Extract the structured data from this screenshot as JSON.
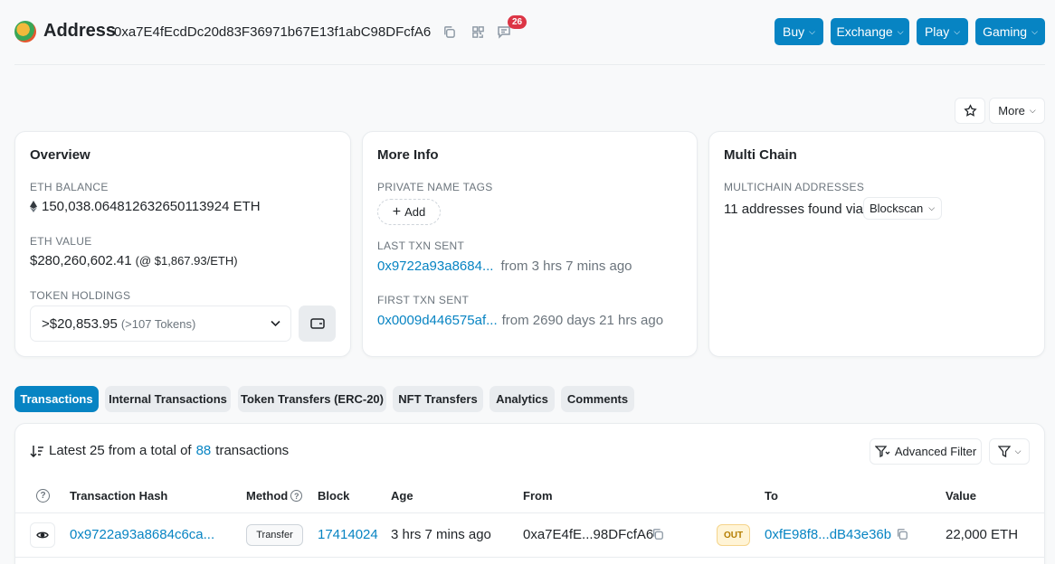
{
  "header": {
    "title": "Address",
    "address": "0xa7E4fEcdDc20d83F36971b67E13f1abC98DFcfA6",
    "comments_count": "26",
    "buttons": [
      {
        "label": "Buy"
      },
      {
        "label": "Exchange"
      },
      {
        "label": "Play"
      },
      {
        "label": "Gaming"
      }
    ]
  },
  "actions": {
    "more_label": "More"
  },
  "overview": {
    "title": "Overview",
    "eth_balance_label": "ETH BALANCE",
    "eth_balance": "150,038.064812632650113924 ETH",
    "eth_value_label": "ETH VALUE",
    "eth_value": "$280,260,602.41",
    "eth_price": "(@ $1,867.93/ETH)",
    "token_holdings_label": "TOKEN HOLDINGS",
    "token_value": ">$20,853.95",
    "token_count": "(>107 Tokens)"
  },
  "more_info": {
    "title": "More Info",
    "private_tags_label": "PRIVATE NAME TAGS",
    "add_label": "Add",
    "last_txn_label": "LAST TXN SENT",
    "last_txn_hash": "0x9722a93a8684...",
    "last_txn_age": "from 3 hrs 7 mins ago",
    "first_txn_label": "FIRST TXN SENT",
    "first_txn_hash": "0x0009d446575af...",
    "first_txn_age": "from 2690 days 21 hrs ago"
  },
  "multi_chain": {
    "title": "Multi Chain",
    "label": "MULTICHAIN ADDRESSES",
    "found_text": "11 addresses found via",
    "selector": "Blockscan"
  },
  "tabs": [
    {
      "label": "Transactions"
    },
    {
      "label": "Internal Transactions"
    },
    {
      "label": "Token Transfers (ERC-20)"
    },
    {
      "label": "NFT Transfers"
    },
    {
      "label": "Analytics"
    },
    {
      "label": "Comments"
    }
  ],
  "txn_summary": {
    "prefix": "Latest 25 from a total of",
    "total": "88",
    "suffix": "transactions"
  },
  "filters": {
    "advanced_label": "Advanced Filter"
  },
  "table": {
    "columns": [
      "Transaction Hash",
      "Method",
      "Block",
      "Age",
      "From",
      "To",
      "Value"
    ],
    "rows": [
      {
        "hash": "0x9722a93a8684c6ca...",
        "method": "Transfer",
        "block": "17414024",
        "age": "3 hrs 7 mins ago",
        "from": "0xa7E4fE...98DFcfA6",
        "direction": "OUT",
        "to": "0xfE98f8...dB43e36b",
        "value": "22,000 ETH"
      }
    ]
  },
  "colors": {
    "primary": "#0784c3",
    "badge_red": "#dc3545",
    "out_badge": "#fff4d6"
  }
}
